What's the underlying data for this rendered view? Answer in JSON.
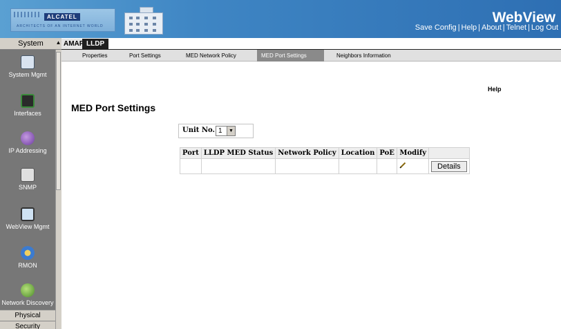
{
  "header": {
    "brand": "ALCATEL",
    "brand_sub": "ARCHITECTS OF AN INTERNET WORLD",
    "app_title": "WebView",
    "links": [
      "Save Config",
      "Help",
      "About",
      "Telnet",
      "Log Out"
    ],
    "link_separator": "|"
  },
  "sidebar": {
    "header": "System",
    "items": [
      {
        "label": "System Mgmt",
        "icon": "system-mgmt-icon"
      },
      {
        "label": "Interfaces",
        "icon": "interfaces-icon"
      },
      {
        "label": "IP Addressing",
        "icon": "ip-addressing-icon"
      },
      {
        "label": "SNMP",
        "icon": "snmp-icon"
      },
      {
        "label": "WebView Mgmt",
        "icon": "webview-mgmt-icon"
      },
      {
        "label": "RMON",
        "icon": "rmon-icon"
      },
      {
        "label": "Network Discovery",
        "icon": "network-discovery-icon"
      }
    ],
    "bottom_items": [
      "Physical",
      "Security"
    ]
  },
  "tabs": [
    {
      "label": "AMAP",
      "active": false
    },
    {
      "label": "LLDP",
      "active": true
    }
  ],
  "subnav": [
    {
      "label": "Properties",
      "active": false
    },
    {
      "label": "Port Settings",
      "active": false
    },
    {
      "label": "MED Network Policy",
      "active": false
    },
    {
      "label": "MED Port Settings",
      "active": true
    },
    {
      "label": "Neighbors Information",
      "active": false
    }
  ],
  "help_label": "Help",
  "page_title": "MED Port Settings",
  "unit": {
    "label": "Unit No.",
    "value": "1"
  },
  "table": {
    "columns": [
      "Port",
      "LLDP MED Status",
      "Network Policy",
      "Location",
      "PoE",
      "Modify"
    ],
    "rows": [
      {
        "port": "",
        "status": "",
        "policy": "",
        "location": "",
        "poe": "",
        "details_label": "Details"
      }
    ]
  },
  "colors": {
    "header_blue": "#3f86c4",
    "sidebar_gray": "#777777",
    "active_tab": "#1f1f1f"
  }
}
